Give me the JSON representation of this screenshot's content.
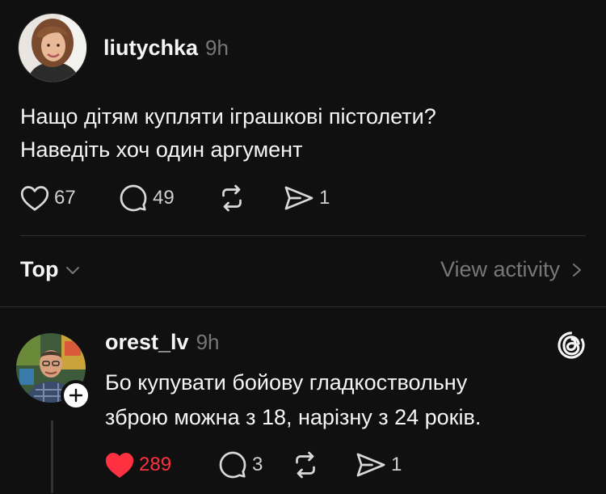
{
  "post": {
    "username": "liutychka",
    "time": "9h",
    "text_line1": "Нащо дітям купляти іграшкові пістолети?",
    "text_line2": "Наведіть хоч один аргумент",
    "likes": "67",
    "replies": "49",
    "shares": "1",
    "icons": [
      "heart-icon",
      "comment-icon",
      "repost-icon",
      "share-icon"
    ]
  },
  "filter": {
    "sort_label": "Top",
    "view_activity_label": "View activity"
  },
  "reply": {
    "username": "orest_lv",
    "time": "9h",
    "text_line1": "Бо купувати бойову гладкоствольну",
    "text_line2": "зброю можна з 18, нарізну з 24 років.",
    "likes": "289",
    "replies": "3",
    "shares": "1",
    "liked": true,
    "like_color": "#ff3040"
  },
  "colors": {
    "background": "#101010",
    "text": "#f3f5f7",
    "muted": "#777777",
    "divider": "#2e2e2e"
  }
}
